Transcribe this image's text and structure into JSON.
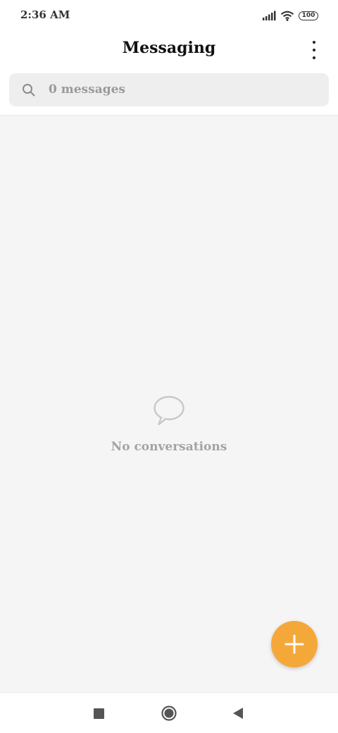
{
  "status_bar": {
    "time": "2:36 AM",
    "battery_level": "100",
    "icons": [
      "signal-icon",
      "wifi-icon",
      "battery-icon"
    ]
  },
  "header": {
    "title": "Messaging",
    "menu_icon": "more-vertical-icon"
  },
  "search": {
    "placeholder": "0 messages",
    "icon": "search-icon"
  },
  "empty_state": {
    "icon": "chat-bubble-icon",
    "text": "No conversations"
  },
  "fab": {
    "icon": "plus-icon",
    "color": "#f5a83a"
  },
  "navigation": {
    "buttons": [
      "recent-apps-icon",
      "home-icon",
      "back-icon"
    ]
  }
}
